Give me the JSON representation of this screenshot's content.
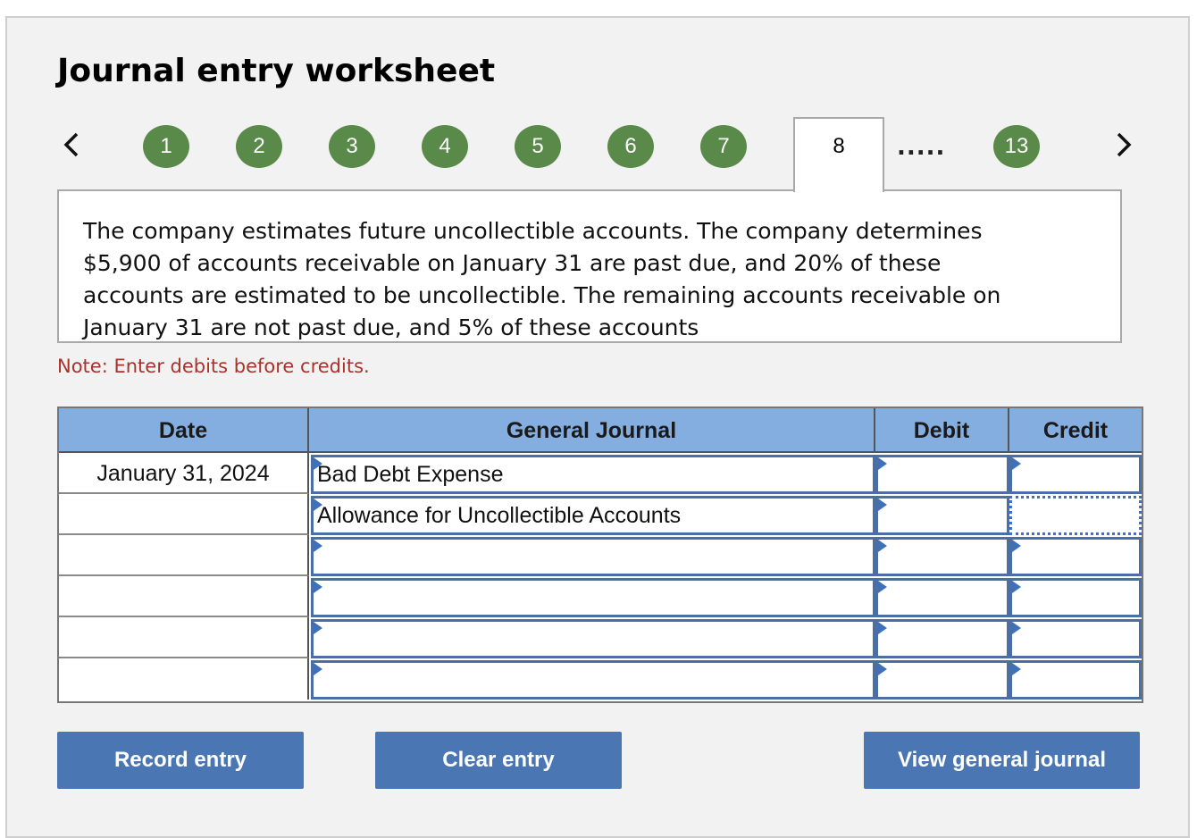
{
  "worksheet": {
    "title": "Journal entry worksheet",
    "steps": [
      "1",
      "2",
      "3",
      "4",
      "5",
      "6",
      "7"
    ],
    "active_step": "8",
    "ellipsis": ".....",
    "last_step": "13",
    "prev_icon": "chevron-left-icon",
    "next_icon": "chevron-right-icon",
    "description": "The company estimates future uncollectible accounts. The company determines $5,900 of accounts receivable on January 31 are past due, and 20% of these accounts are estimated to be uncollectible. The remaining accounts receivable on January 31 are not past due, and 5% of these accounts",
    "note": "Note: Enter debits before credits."
  },
  "table": {
    "headers": {
      "date": "Date",
      "journal": "General Journal",
      "debit": "Debit",
      "credit": "Credit"
    },
    "rows": [
      {
        "date": "January 31, 2024",
        "account": "Bad Debt Expense",
        "debit": "",
        "credit": ""
      },
      {
        "date": "",
        "account": "Allowance for Uncollectible Accounts",
        "debit": "",
        "credit": ""
      },
      {
        "date": "",
        "account": "",
        "debit": "",
        "credit": ""
      },
      {
        "date": "",
        "account": "",
        "debit": "",
        "credit": ""
      },
      {
        "date": "",
        "account": "",
        "debit": "",
        "credit": ""
      },
      {
        "date": "",
        "account": "",
        "debit": "",
        "credit": ""
      }
    ]
  },
  "buttons": {
    "record": "Record entry",
    "clear": "Clear entry",
    "view": "View general journal"
  },
  "colors": {
    "step_green": "#5a8a4a",
    "header_blue": "#84ade0",
    "button_blue": "#4a77b4",
    "note_red": "#a8332b"
  }
}
